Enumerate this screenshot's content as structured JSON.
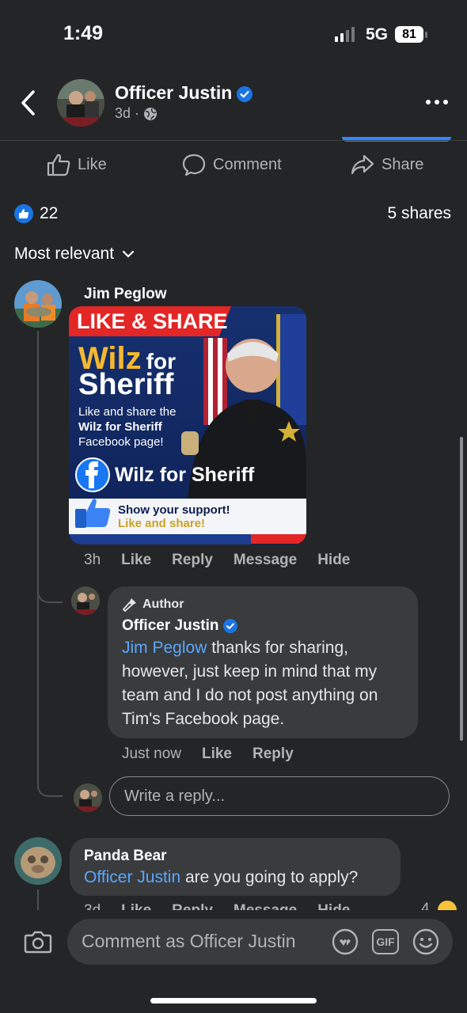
{
  "status_bar": {
    "time": "1:49",
    "network": "5G",
    "battery": "81"
  },
  "header": {
    "name": "Officer Justin",
    "age": "3d"
  },
  "actions": {
    "like": "Like",
    "comment": "Comment",
    "share": "Share"
  },
  "summary": {
    "reactions_count": "22",
    "shares": "5 shares"
  },
  "sort": {
    "label": "Most relevant"
  },
  "comments": [
    {
      "author": "Jim Peglow",
      "image": {
        "banner": "LIKE & SHARE",
        "headline_1": "Wilz",
        "headline_1b": "for",
        "headline_2": "Sheriff",
        "body_line_1": "Like and share the",
        "body_line_2": "Wilz for Sheriff",
        "body_line_3": "Facebook page!",
        "fb_page": "Wilz for Sheriff",
        "support_1": "Show your support!",
        "support_2": "Like and share!"
      },
      "time": "3h",
      "like": "Like",
      "reply": "Reply",
      "message": "Message",
      "hide": "Hide"
    }
  ],
  "reply": {
    "tag": "Author",
    "author": "Officer Justin",
    "mention": "Jim Peglow",
    "text_1": " thanks for sharing,",
    "text_2": "however, just keep in mind that my",
    "text_3": "team and I do not post anything on",
    "text_4": "Tim's Facebook page.",
    "time": "Just now",
    "like": "Like",
    "reply": "Reply"
  },
  "reply_input": {
    "placeholder": "Write a reply..."
  },
  "comment2": {
    "author": "Panda Bear",
    "mention": "Officer Justin",
    "text": " are you going to apply?",
    "time": "3d",
    "like": "Like",
    "reply": "Reply",
    "message": "Message",
    "hide": "Hide",
    "reaction_count": "4"
  },
  "composer": {
    "placeholder": "Comment as Officer Justin",
    "gif": "GIF"
  },
  "colors": {
    "accent": "#1b74e4",
    "mention": "#5aa7ff",
    "background": "#242526",
    "bubble": "#3a3b3c"
  }
}
